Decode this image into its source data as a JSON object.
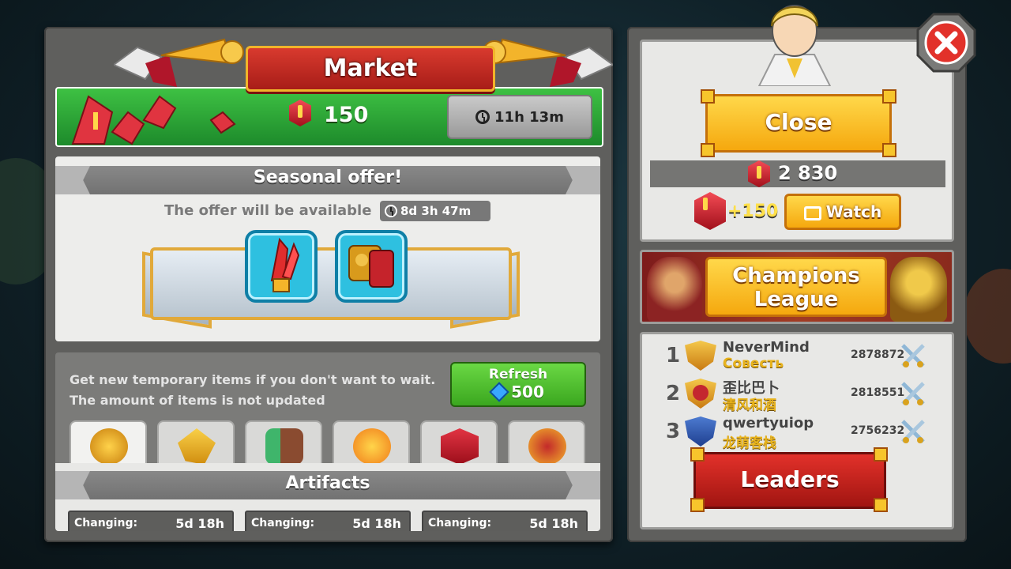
{
  "market": {
    "title": "Market",
    "gems": "150",
    "timer": "11h 13m",
    "seasonal": {
      "title": "Seasonal offer!",
      "available_text": "The offer will be available",
      "available_timer": "8d 3h 47m"
    },
    "shop": {
      "description_line1": "Get new temporary items if you don't want to wait.",
      "description_line2": "The amount of items is not updated",
      "refresh_label": "Refresh",
      "refresh_cost": "500",
      "tabs": [
        "hc-badge-icon",
        "golden-crystal-icon",
        "potion-icon",
        "fire-amulet-icon",
        "gem-book-icon",
        "shield-crest-icon"
      ]
    },
    "artifacts": {
      "title": "Artifacts",
      "cards": [
        {
          "label": "Changing:",
          "time": "5d 18h"
        },
        {
          "label": "Changing:",
          "time": "5d 18h"
        },
        {
          "label": "Changing:",
          "time": "5d 18h"
        }
      ]
    }
  },
  "side": {
    "close_label": "Close",
    "gems_total": "2 830",
    "bonus": "+150",
    "watch_label": "Watch",
    "champions_label_line1": "Champions",
    "champions_label_line2": "League",
    "leaders_label": "Leaders",
    "leaderboard": [
      {
        "rank": "1",
        "name": "NeverMind",
        "guild": "Совесть",
        "score": "2878872"
      },
      {
        "rank": "2",
        "name": "歪比巴卜",
        "guild": "清风和酒",
        "score": "2818551"
      },
      {
        "rank": "3",
        "name": "qwertyuiop",
        "guild": "龙萌客栈",
        "score": "2756232"
      }
    ]
  },
  "colors": {
    "accent_red": "#c8231c",
    "accent_gold": "#f5a80e",
    "green": "#3ec143"
  }
}
